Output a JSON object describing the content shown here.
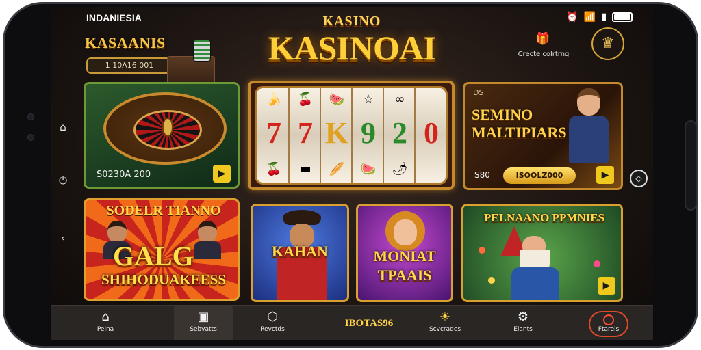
{
  "status_bar": {
    "country": "INDANIESIA"
  },
  "header": {
    "brand": "KASAANIS",
    "chip_box_text": "1 10A16 001",
    "main_small": "KASINO",
    "main_title": "KASINOAI",
    "top_right_label": "Crecte colrtrng",
    "top_right_icon": "gift-icon",
    "top_right_badge_icon": "crown-icon"
  },
  "cards": {
    "roulette": {
      "amount": "S0230A 200",
      "play_icon": "play-icon"
    },
    "slot": {
      "symbols": [
        "7",
        "7",
        "K",
        "9",
        "2",
        "0"
      ],
      "colors": [
        "#d3251d",
        "#d3251d",
        "#e0a020",
        "#2a8a2a",
        "#2a8a2a",
        "#d3251d"
      ]
    },
    "multipliers": {
      "corner": "DS",
      "title": "SEMINO MALTIPIARS",
      "small_value": "S80",
      "pill": "ISOOLZ000"
    },
    "gang": {
      "top": "SODELR TIANNO",
      "middle": "GALG",
      "bottom": "SHIHODUAKEESS"
    },
    "kahan": {
      "title": "KAHAN"
    },
    "moniat": {
      "title": "MONIAT TPAAIS"
    },
    "pelnaaino": {
      "title": "PELNAANO PPMNIES"
    }
  },
  "bottom_nav": {
    "items": [
      {
        "label": "Pelna",
        "icon": "home-icon"
      },
      {
        "label": "Sebvatts",
        "icon": "wallet-icon"
      },
      {
        "label": "Revctds",
        "icon": "shield-icon"
      },
      {
        "label": "Scvcrades",
        "icon": "sun-icon"
      },
      {
        "label": "Elants",
        "icon": "gear-icon"
      }
    ],
    "center_text": "IBOTAS96",
    "last_label": "Ftarels",
    "last_icon": "ring-icon"
  },
  "colors": {
    "gold": "#ffcf3a",
    "accent_red": "#e04a2a",
    "frame_gold": "#c4892b"
  }
}
